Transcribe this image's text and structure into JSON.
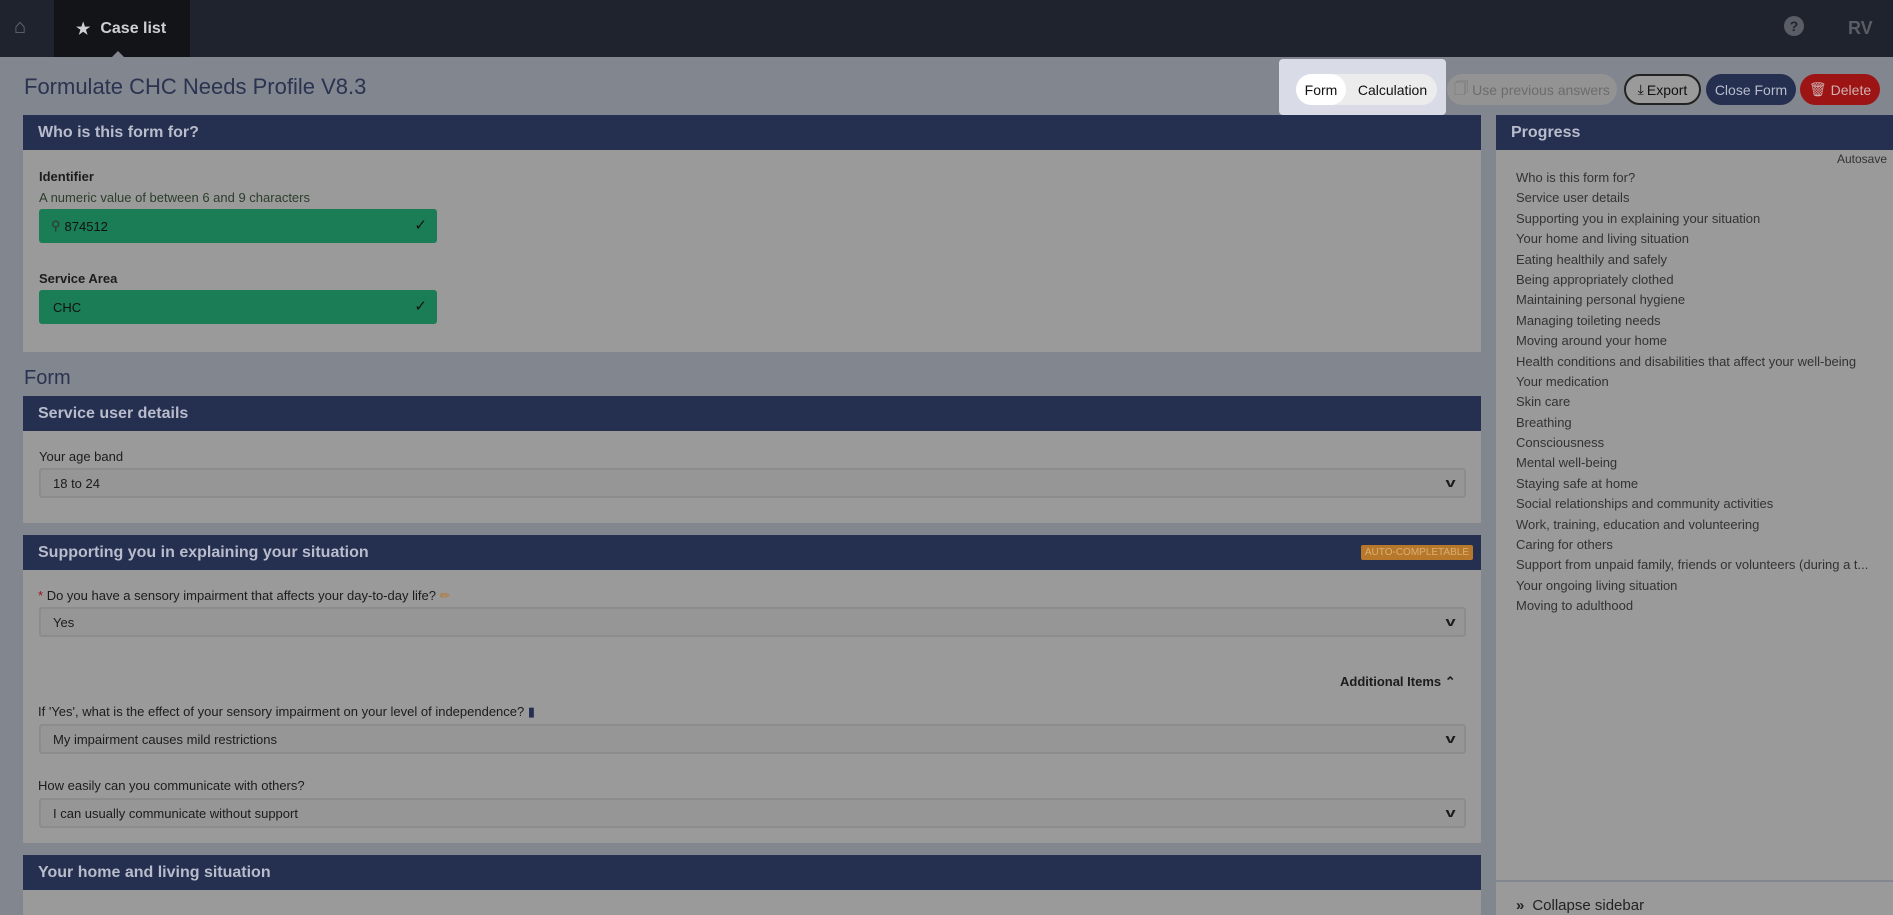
{
  "nav": {
    "home_icon": "home-icon",
    "tab_label": "Case list",
    "tab_icon": "star-icon",
    "help_icon": "question-circle-icon",
    "user_initials": "RV"
  },
  "page": {
    "title": "Formulate CHC Needs Profile V8.3"
  },
  "toolbar": {
    "form": "Form",
    "calculation": "Calculation",
    "use_previous": "Use previous answers",
    "export": "Export",
    "close": "Close Form",
    "delete": "Delete"
  },
  "who": {
    "header": "Who is this form for?",
    "identifier_label": "Identifier",
    "identifier_hint": "A numeric value of between 6 and 9 characters",
    "identifier_value": "874512",
    "service_area_label": "Service Area",
    "service_area_value": "CHC"
  },
  "form_heading": "Form",
  "service_user": {
    "header": "Service user details",
    "age_label": "Your age band",
    "age_value": "18 to 24"
  },
  "supporting": {
    "header": "Supporting you in explaining your situation",
    "badge": "AUTO-COMPLETABLE",
    "q1_required": "*",
    "q1_label": "Do you have a sensory impairment that affects your day-to-day life?",
    "q1_value": "Yes",
    "additional": "Additional Items",
    "q2_label": "If 'Yes', what is the effect of your sensory impairment on your level of independence?",
    "q2_value": "My impairment causes mild restrictions",
    "q3_label": "How easily can you communicate with others?",
    "q3_value": "I can usually communicate without support"
  },
  "home": {
    "header": "Your home and living situation"
  },
  "progress": {
    "header": "Progress",
    "autosave": "Autosave",
    "items": [
      "Who is this form for?",
      "Service user details",
      "Supporting you in explaining your situation",
      "Your home and living situation",
      "Eating healthily and safely",
      "Being appropriately clothed",
      "Maintaining personal hygiene",
      "Managing toileting needs",
      "Moving around your home",
      "Health conditions and disabilities that affect your well-being",
      "Your medication",
      "Skin care",
      "Breathing",
      "Consciousness",
      "Mental well-being",
      "Staying safe at home",
      "Social relationships and community activities",
      "Work, training, education and volunteering",
      "Caring for others",
      "Support from unpaid family, friends or volunteers (during a t...",
      "Your ongoing living situation",
      "Moving to adulthood"
    ],
    "collapse": "Collapse sidebar"
  },
  "colors": {
    "header": "#252f50",
    "valid": "#1a7d55",
    "delete": "#9c1414",
    "badge": "#b8782c"
  }
}
